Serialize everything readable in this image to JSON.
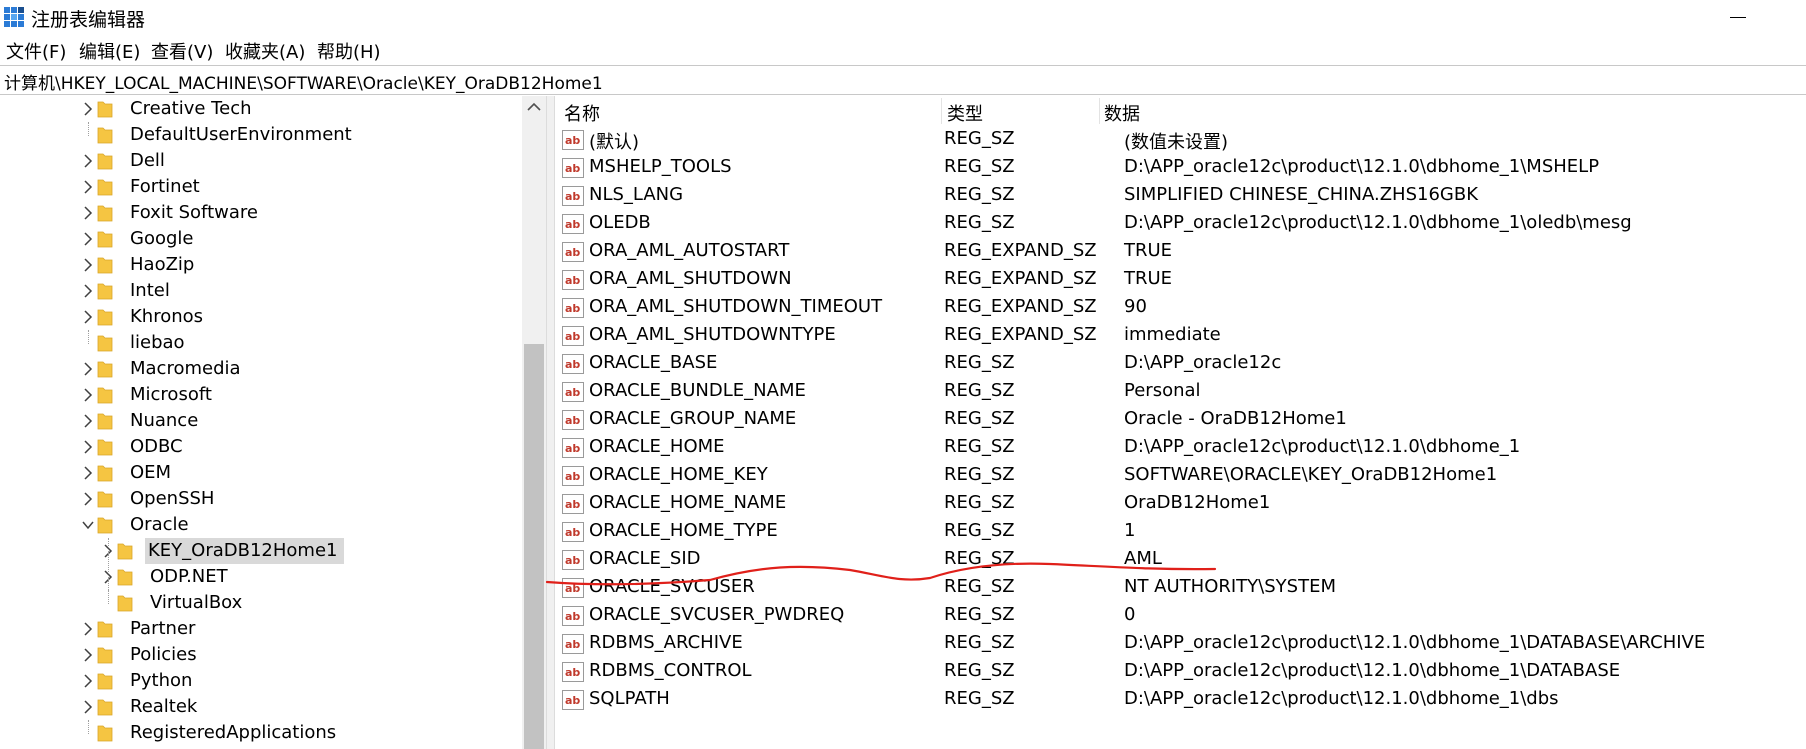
{
  "window": {
    "title": "注册表编辑器"
  },
  "menu": [
    {
      "label": "文件(F)"
    },
    {
      "label": "编辑(E)"
    },
    {
      "label": "查看(V)"
    },
    {
      "label": "收藏夹(A)"
    },
    {
      "label": "帮助(H)"
    }
  ],
  "address": {
    "path": "计算机\\HKEY_LOCAL_MACHINE\\SOFTWARE\\Oracle\\KEY_OraDB12Home1"
  },
  "tree": {
    "items": [
      {
        "label": "Creative Tech",
        "level": 0,
        "expander": "collapsed"
      },
      {
        "label": "DefaultUserEnvironment",
        "level": 0,
        "expander": "none"
      },
      {
        "label": "Dell",
        "level": 0,
        "expander": "collapsed"
      },
      {
        "label": "Fortinet",
        "level": 0,
        "expander": "collapsed"
      },
      {
        "label": "Foxit Software",
        "level": 0,
        "expander": "collapsed"
      },
      {
        "label": "Google",
        "level": 0,
        "expander": "collapsed"
      },
      {
        "label": "HaoZip",
        "level": 0,
        "expander": "collapsed"
      },
      {
        "label": "Intel",
        "level": 0,
        "expander": "collapsed"
      },
      {
        "label": "Khronos",
        "level": 0,
        "expander": "collapsed"
      },
      {
        "label": "liebao",
        "level": 0,
        "expander": "none"
      },
      {
        "label": "Macromedia",
        "level": 0,
        "expander": "collapsed"
      },
      {
        "label": "Microsoft",
        "level": 0,
        "expander": "collapsed"
      },
      {
        "label": "Nuance",
        "level": 0,
        "expander": "collapsed"
      },
      {
        "label": "ODBC",
        "level": 0,
        "expander": "collapsed"
      },
      {
        "label": "OEM",
        "level": 0,
        "expander": "collapsed"
      },
      {
        "label": "OpenSSH",
        "level": 0,
        "expander": "collapsed"
      },
      {
        "label": "Oracle",
        "level": 0,
        "expander": "expanded"
      },
      {
        "label": "KEY_OraDB12Home1",
        "level": 1,
        "expander": "collapsed",
        "selected": true
      },
      {
        "label": "ODP.NET",
        "level": 1,
        "expander": "collapsed"
      },
      {
        "label": "VirtualBox",
        "level": 1,
        "expander": "none"
      },
      {
        "label": "Partner",
        "level": 0,
        "expander": "collapsed"
      },
      {
        "label": "Policies",
        "level": 0,
        "expander": "collapsed"
      },
      {
        "label": "Python",
        "level": 0,
        "expander": "collapsed"
      },
      {
        "label": "Realtek",
        "level": 0,
        "expander": "collapsed"
      },
      {
        "label": "RegisteredApplications",
        "level": 0,
        "expander": "none"
      }
    ]
  },
  "values": {
    "headers": {
      "name": "名称",
      "type": "类型",
      "data": "数据"
    },
    "rows": [
      {
        "name": "(默认)",
        "type": "REG_SZ",
        "data": "(数值未设置)"
      },
      {
        "name": "MSHELP_TOOLS",
        "type": "REG_SZ",
        "data": "D:\\APP_oracle12c\\product\\12.1.0\\dbhome_1\\MSHELP"
      },
      {
        "name": "NLS_LANG",
        "type": "REG_SZ",
        "data": "SIMPLIFIED CHINESE_CHINA.ZHS16GBK"
      },
      {
        "name": "OLEDB",
        "type": "REG_SZ",
        "data": "D:\\APP_oracle12c\\product\\12.1.0\\dbhome_1\\oledb\\mesg"
      },
      {
        "name": "ORA_AML_AUTOSTART",
        "type": "REG_EXPAND_SZ",
        "data": "TRUE"
      },
      {
        "name": "ORA_AML_SHUTDOWN",
        "type": "REG_EXPAND_SZ",
        "data": "TRUE"
      },
      {
        "name": "ORA_AML_SHUTDOWN_TIMEOUT",
        "type": "REG_EXPAND_SZ",
        "data": "90"
      },
      {
        "name": "ORA_AML_SHUTDOWNTYPE",
        "type": "REG_EXPAND_SZ",
        "data": "immediate"
      },
      {
        "name": "ORACLE_BASE",
        "type": "REG_SZ",
        "data": "D:\\APP_oracle12c"
      },
      {
        "name": "ORACLE_BUNDLE_NAME",
        "type": "REG_SZ",
        "data": "Personal"
      },
      {
        "name": "ORACLE_GROUP_NAME",
        "type": "REG_SZ",
        "data": "Oracle - OraDB12Home1"
      },
      {
        "name": "ORACLE_HOME",
        "type": "REG_SZ",
        "data": "D:\\APP_oracle12c\\product\\12.1.0\\dbhome_1"
      },
      {
        "name": "ORACLE_HOME_KEY",
        "type": "REG_SZ",
        "data": "SOFTWARE\\ORACLE\\KEY_OraDB12Home1"
      },
      {
        "name": "ORACLE_HOME_NAME",
        "type": "REG_SZ",
        "data": "OraDB12Home1"
      },
      {
        "name": "ORACLE_HOME_TYPE",
        "type": "REG_SZ",
        "data": "1"
      },
      {
        "name": "ORACLE_SID",
        "type": "REG_SZ",
        "data": "AML"
      },
      {
        "name": "ORACLE_SVCUSER",
        "type": "REG_SZ",
        "data": "NT AUTHORITY\\SYSTEM"
      },
      {
        "name": "ORACLE_SVCUSER_PWDREQ",
        "type": "REG_SZ",
        "data": "0"
      },
      {
        "name": "RDBMS_ARCHIVE",
        "type": "REG_SZ",
        "data": "D:\\APP_oracle12c\\product\\12.1.0\\dbhome_1\\DATABASE\\ARCHIVE"
      },
      {
        "name": "RDBMS_CONTROL",
        "type": "REG_SZ",
        "data": "D:\\APP_oracle12c\\product\\12.1.0\\dbhome_1\\DATABASE"
      },
      {
        "name": "SQLPATH",
        "type": "REG_SZ",
        "data": "D:\\APP_oracle12c\\product\\12.1.0\\dbhome_1\\dbs"
      }
    ]
  },
  "colors": {
    "folder": "#f5c542",
    "ab_icon": "#c0392b",
    "annotation": "#e0201a",
    "selection": "#d9d9d9"
  },
  "icons": {
    "app": "registry-editor-icon",
    "folder": "folder-icon",
    "value": "string-value-icon"
  }
}
